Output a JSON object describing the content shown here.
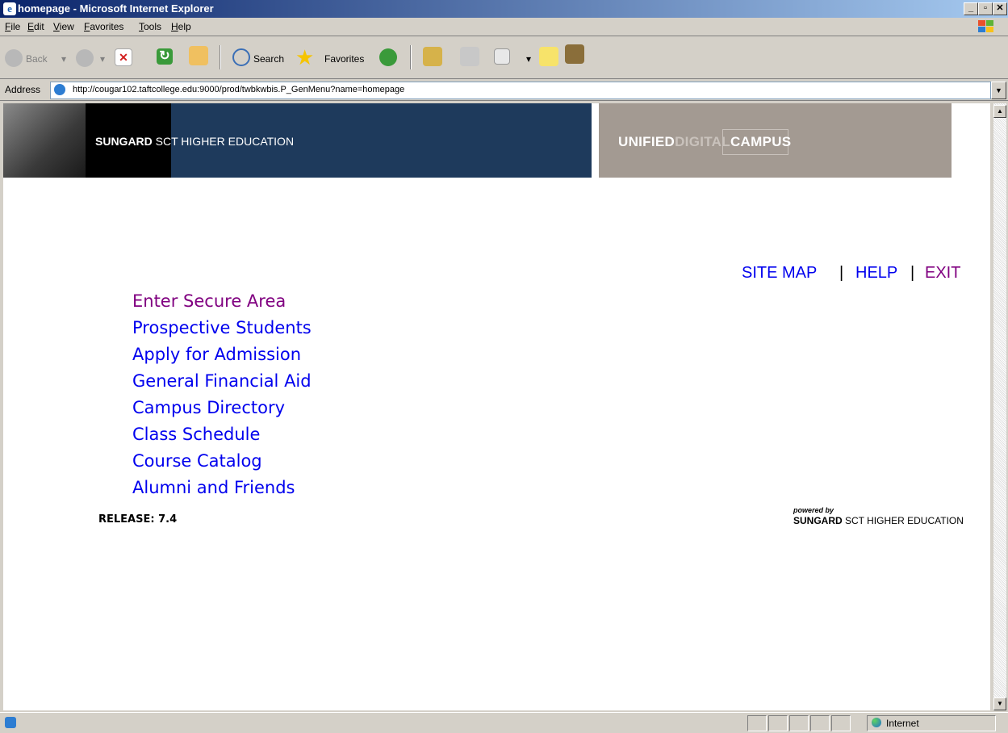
{
  "window": {
    "title": "homepage - Microsoft Internet Explorer"
  },
  "menu": [
    "File",
    "Edit",
    "View",
    "Favorites",
    "Tools",
    "Help"
  ],
  "toolbar": {
    "back": "Back",
    "search": "Search",
    "favorites": "Favorites"
  },
  "address": {
    "label": "Address",
    "url": "http://cougar102.taftcollege.edu:9000/prod/twbkwbis.P_GenMenu?name=homepage"
  },
  "banner": {
    "brand_bold": "SUNGARD",
    "brand_rest": "SCT HIGHER EDUCATION",
    "udc_1": "UNIFIED",
    "udc_2": "DIGITAL",
    "udc_3": "CAMPUS",
    "colors": {
      "blue": "#1e3a5c",
      "gray": "#a39a92"
    }
  },
  "toplinks": {
    "site_map": "SITE MAP",
    "help": "HELP",
    "exit": "EXIT",
    "separator": "|"
  },
  "nav": [
    {
      "label": "Enter Secure Area",
      "visited": true
    },
    {
      "label": "Prospective Students",
      "visited": false
    },
    {
      "label": "Apply for Admission",
      "visited": false
    },
    {
      "label": "General Financial Aid",
      "visited": false
    },
    {
      "label": "Campus Directory",
      "visited": false
    },
    {
      "label": "Class Schedule",
      "visited": false
    },
    {
      "label": "Course Catalog",
      "visited": false
    },
    {
      "label": "Alumni and Friends",
      "visited": false
    }
  ],
  "release": "RELEASE: 7.4",
  "footer": {
    "powered_by": "powered by",
    "brand_bold": "SUNGARD",
    "brand_rest": "SCT HIGHER EDUCATION"
  },
  "status": {
    "zone": "Internet"
  }
}
